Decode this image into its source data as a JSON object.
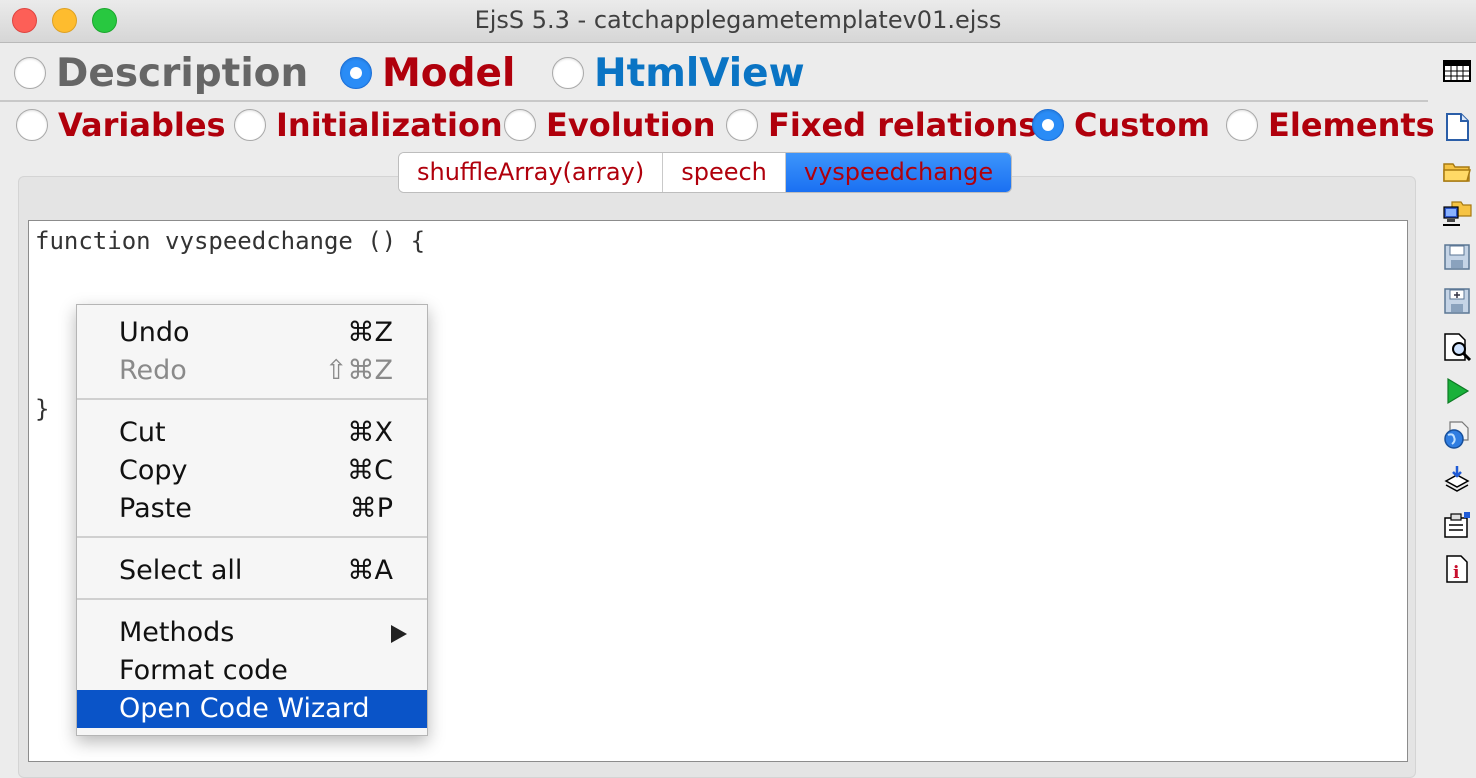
{
  "window": {
    "title": "EjsS 5.3 - catchapplegametemplatev01.ejss"
  },
  "top_tabs": [
    {
      "label": "Description",
      "selected": false,
      "color": "#666666"
    },
    {
      "label": "Model",
      "selected": true,
      "color": "#b0000c"
    },
    {
      "label": "HtmlView",
      "selected": false,
      "color": "#0a74c4"
    }
  ],
  "model_tabs": [
    {
      "label": "Variables",
      "selected": false
    },
    {
      "label": "Initialization",
      "selected": false
    },
    {
      "label": "Evolution",
      "selected": false
    },
    {
      "label": "Fixed relations",
      "selected": false
    },
    {
      "label": "Custom",
      "selected": true
    },
    {
      "label": "Elements",
      "selected": false
    }
  ],
  "custom_tabs": [
    {
      "label": "shuffleArray(array)",
      "active": false
    },
    {
      "label": "speech",
      "active": false
    },
    {
      "label": "vyspeedchange",
      "active": true
    }
  ],
  "editor": {
    "lines": [
      "function vyspeedchange () {",
      "}"
    ]
  },
  "context_menu": {
    "groups": [
      [
        {
          "label": "Undo",
          "shortcut": "⌘Z",
          "enabled": true
        },
        {
          "label": "Redo",
          "shortcut": "⇧⌘Z",
          "enabled": false
        }
      ],
      [
        {
          "label": "Cut",
          "shortcut": "⌘X",
          "enabled": true
        },
        {
          "label": "Copy",
          "shortcut": "⌘C",
          "enabled": true
        },
        {
          "label": "Paste",
          "shortcut": "⌘P",
          "enabled": true
        }
      ],
      [
        {
          "label": "Select all",
          "shortcut": "⌘A",
          "enabled": true
        }
      ],
      [
        {
          "label": "Methods",
          "submenu": true
        },
        {
          "label": "Format code"
        },
        {
          "label": "Open Code Wizard",
          "highlighted": true
        }
      ]
    ]
  },
  "toolbar_icons": [
    "table-icon",
    "new-file-icon",
    "open-folder-icon",
    "open-network-icon",
    "save-icon",
    "save-as-icon",
    "search-document-icon",
    "run-icon",
    "web-icon",
    "install-icon",
    "properties-icon",
    "info-icon"
  ],
  "colors": {
    "accent_blue": "#1a70f2",
    "menu_highlight": "#0a54c8",
    "label_red": "#b0000c"
  }
}
